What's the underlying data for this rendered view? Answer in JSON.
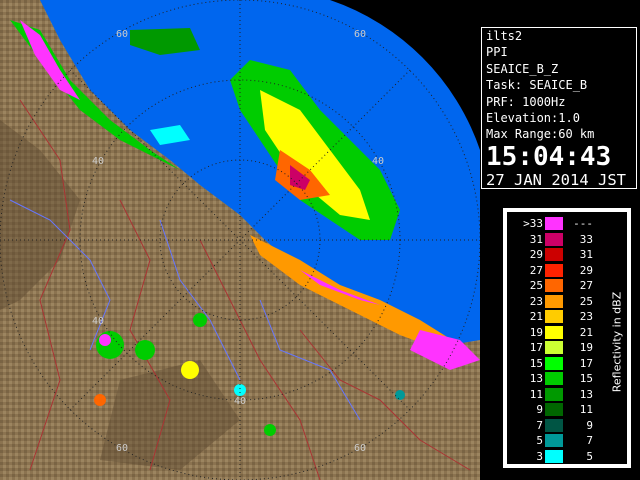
{
  "info_panel": {
    "site": "ilts2",
    "product": "PPI",
    "product_name": "SEAICE_B_Z",
    "task": "Task: SEAICE_B",
    "prf": "PRF: 1000Hz",
    "elevation": "Elevation:1.0",
    "max_range": "Max Range:60 km",
    "time": "15:04:43",
    "date": "27 JAN 2014 JST"
  },
  "range_rings": {
    "labels": [
      "40",
      "40",
      "40",
      "40",
      "60",
      "60",
      "60",
      "60"
    ]
  },
  "legend": {
    "title": "Reflectivity in dBZ",
    "rows": [
      {
        "left": ">33",
        "right": "---",
        "color": "#ff33ff"
      },
      {
        "left": "31",
        "right": "33",
        "color": "#cc0066"
      },
      {
        "left": "29",
        "right": "31",
        "color": "#cc0000"
      },
      {
        "left": "27",
        "right": "29",
        "color": "#ff2200"
      },
      {
        "left": "25",
        "right": "27",
        "color": "#ff6600"
      },
      {
        "left": "23",
        "right": "25",
        "color": "#ff9900"
      },
      {
        "left": "21",
        "right": "23",
        "color": "#ffcc00"
      },
      {
        "left": "19",
        "right": "21",
        "color": "#ffff00"
      },
      {
        "left": "17",
        "right": "19",
        "color": "#ccff33"
      },
      {
        "left": "15",
        "right": "17",
        "color": "#00ff00"
      },
      {
        "left": "13",
        "right": "15",
        "color": "#00cc00"
      },
      {
        "left": "11",
        "right": "13",
        "color": "#009900"
      },
      {
        "left": "9",
        "right": "11",
        "color": "#006600"
      },
      {
        "left": "7",
        "right": "9",
        "color": "#005544"
      },
      {
        "left": "5",
        "right": "7",
        "color": "#009999"
      },
      {
        "left": "3",
        "right": "5",
        "color": "#00ffff"
      }
    ]
  },
  "colors": {
    "sea": "#0066ee",
    "land": "#8b7350",
    "land_dark": "#5e4a30",
    "ring": "#222222",
    "border_red": "#aa3333",
    "river_blue": "#6677ff"
  }
}
